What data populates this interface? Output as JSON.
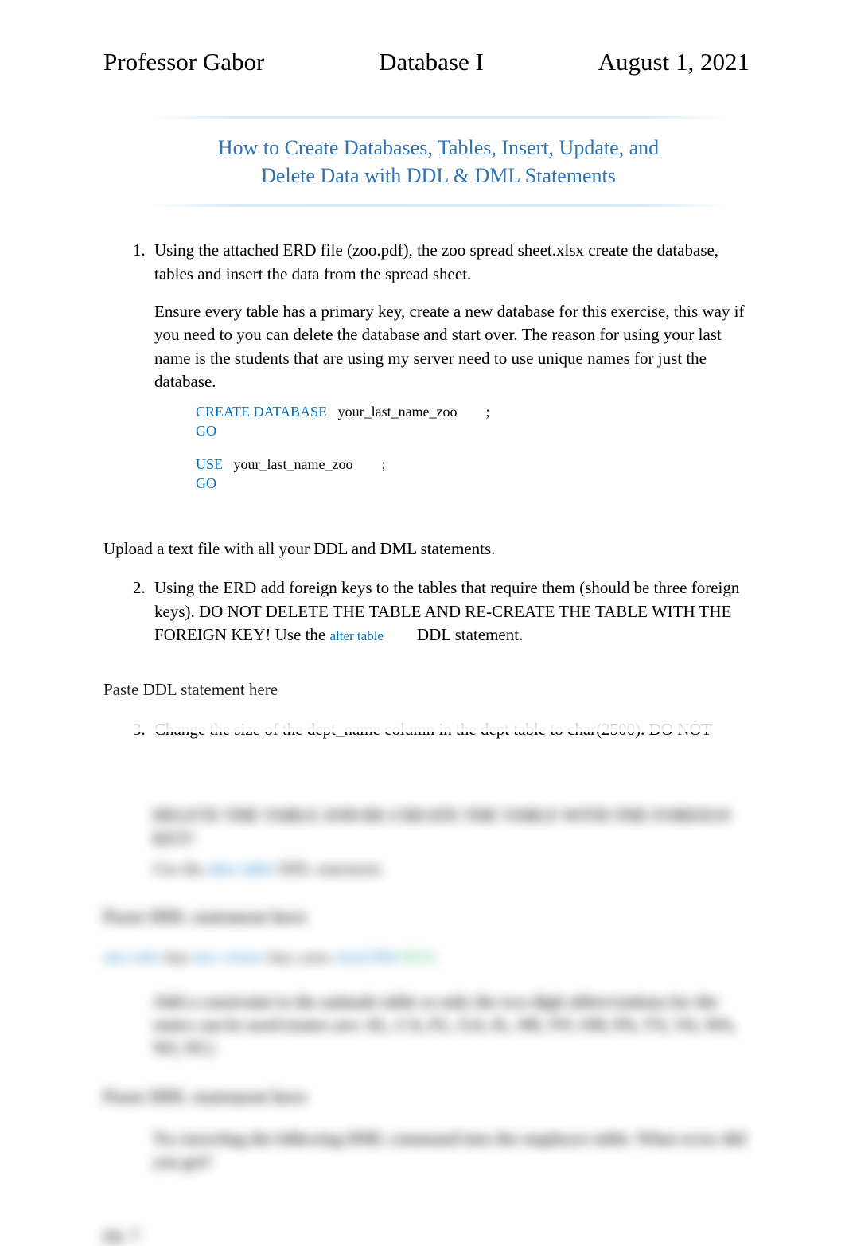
{
  "header": {
    "left": "Professor Gabor",
    "center": "Database I",
    "right": "August 1, 2021"
  },
  "title": "How to Create Databases, Tables, Insert, Update, and Delete Data with DDL & DML Statements",
  "items": {
    "q1": {
      "num": "1.",
      "text": "Using the attached ERD file (zoo.pdf), the zoo spread sheet.xlsx create the database, tables and insert the data from the spread sheet.",
      "para2": "Ensure every table has a primary key, create a new database for this exercise, this way if you need to you can delete the database and start over. The reason for using your last name is the students that are using my server need to use unique names for just the database."
    },
    "code": {
      "create_kw": "CREATE DATABASE",
      "dbname": "your_last_name_zoo",
      "semi": ";",
      "go": "GO",
      "use_kw": "USE"
    },
    "upload": "Upload a text file with all your DDL and DML statements.",
    "q2": {
      "text_a": "Using the ERD add foreign keys to the tables that require them (should be three foreign keys). DO NOT DELETE THE TABLE AND RE-CREATE THE TABLE WITH THE FOREIGN KEY! Use the ",
      "alter": "alter table",
      "text_b": " DDL statement."
    },
    "paste": "Paste DDL statement here",
    "q3": {
      "text": "Change the size of the dept_name column in the dept table to char(2500). DO NOT"
    }
  },
  "blurred": {
    "line1_a": "DELETE THE TABLE AND RE-CREATE THE TABLE WITH THE FOREIGN KEY!",
    "line1_b": "Use the ",
    "line1_c": "alter table",
    "line1_d": " DDL statement.",
    "heading1": "Paste DDL statement here",
    "line2_a": "alter table",
    "line2_b": " dept ",
    "line2_c": "alter column",
    "line2_d": " dept_name ",
    "line2_e": "char(2500)",
    "line2_f": " NULL",
    "q4": "Add a constraint to the animals table so only the two-digit abbreviations for the states can be used  (states are: AL, CA, FL, GA, IL, MI, NY, OH, PA, TX, VA, WA, WI, NC)",
    "heading2": "Paste DDL statement here",
    "q5": "Try inserting the following DML command into the employee table.  What error did you get?",
    "pg": "pg. 1"
  }
}
